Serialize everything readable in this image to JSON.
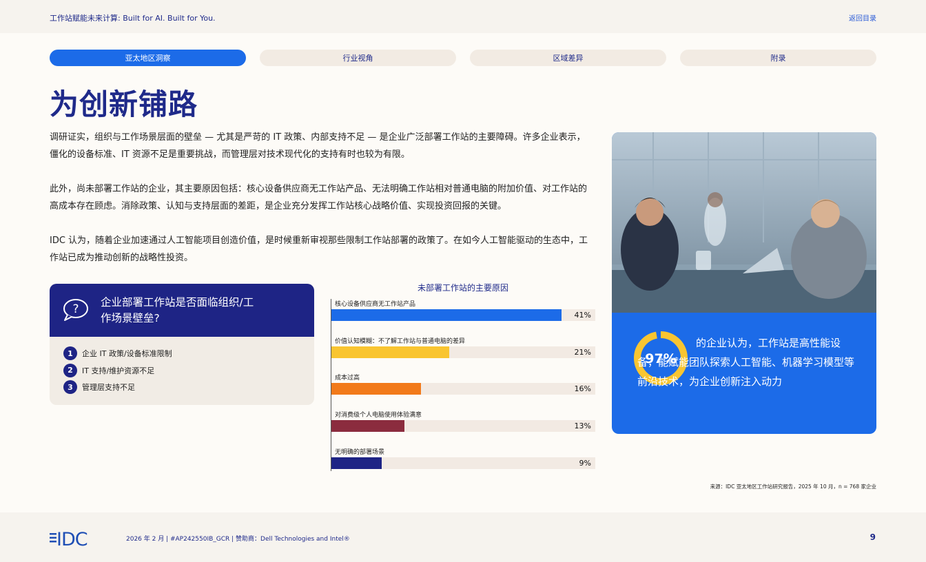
{
  "header": {
    "title": "工作站赋能未来计算: Built for AI. Built for You.",
    "back_link": "返回目录"
  },
  "tabs": [
    {
      "label": "亚太地区洞察",
      "active": true
    },
    {
      "label": "行业视角",
      "active": false
    },
    {
      "label": "区域差异",
      "active": false
    },
    {
      "label": "附录",
      "active": false
    }
  ],
  "page_title": "为创新铺路",
  "paragraphs": [
    "调研证实，组织与工作场景层面的壁垒 — 尤其是严苛的 IT 政策、内部支持不足 — 是企业广泛部署工作站的主要障碍。许多企业表示，僵化的设备标准、IT 资源不足是重要挑战，而管理层对技术现代化的支持有时也较为有限。",
    "此外，尚未部署工作站的企业，其主要原因包括：核心设备供应商无工作站产品、无法明确工作站相对普通电脑的附加价值、对工作站的高成本存在顾虑。消除政策、认知与支持层面的差距，是企业充分发挥工作站核心战略价值、实现投资回报的关键。",
    "IDC 认为，随着企业加速通过人工智能项目创造价值，是时候重新审视那些限制工作站部署的政策了。在如今人工智能驱动的生态中，工作站已成为推动创新的战略性投资。"
  ],
  "question_box": {
    "icon": "question-bubble-icon",
    "title": "企业部署工作站是否面临组织/工作场景壁垒?",
    "items": [
      {
        "num": "1",
        "text": "企业 IT 政策/设备标准限制"
      },
      {
        "num": "2",
        "text": "IT 支持/维护资源不足"
      },
      {
        "num": "3",
        "text": "管理层支持不足"
      }
    ]
  },
  "chart_data": {
    "type": "bar",
    "orientation": "horizontal",
    "title": "未部署工作站的主要原因",
    "categories": [
      "核心设备供应商无工作站产品",
      "价值认知模糊：不了解工作站与普通电脑的差异",
      "成本过高",
      "对消费级个人电脑使用体验满意",
      "无明确的部署场景"
    ],
    "values": [
      41,
      21,
      16,
      13,
      9
    ],
    "value_labels": [
      "41%",
      "21%",
      "16%",
      "13%",
      "9%"
    ],
    "colors": [
      "#1c6be8",
      "#f9c531",
      "#f27a1a",
      "#8b2c3e",
      "#1e2485"
    ],
    "xlim": [
      0,
      47
    ]
  },
  "stat_card": {
    "percent": "97%",
    "value": 0.97,
    "text": "的企业认为，工作站是高性能设备，能赋能团队探索人工智能、机器学习模型等前沿技术，为企业创新注入动力",
    "ring_color": "#f9c531",
    "photo_alt_icon": "office-meeting-photo"
  },
  "source": "来源：IDC 亚太地区工作站研究报告，2025 年 10 月，n = 768 家企业",
  "footer": {
    "logo": "IDC",
    "meta": "2026 年 2 月   |   #AP242550IB_GCR   |   赞助商：Dell Technologies and Intel®",
    "page": "9"
  }
}
